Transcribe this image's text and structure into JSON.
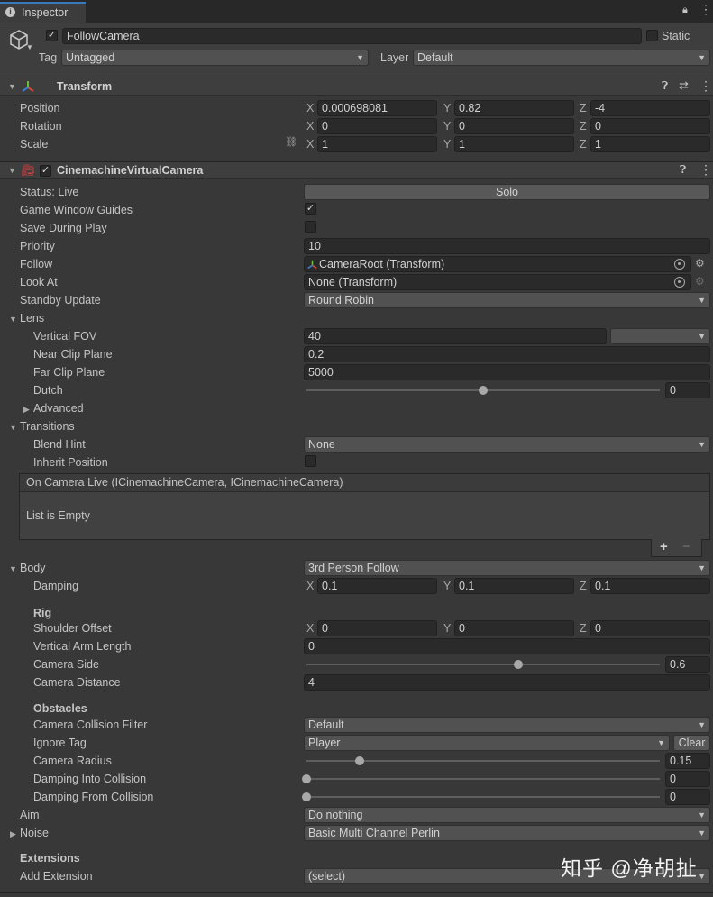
{
  "tab": {
    "title": "Inspector"
  },
  "gameobject": {
    "name": "FollowCamera",
    "static_label": "Static",
    "tag_label": "Tag",
    "tag_value": "Untagged",
    "layer_label": "Layer",
    "layer_value": "Default"
  },
  "transform": {
    "title": "Transform",
    "position_label": "Position",
    "rotation_label": "Rotation",
    "scale_label": "Scale",
    "axes": [
      "X",
      "Y",
      "Z"
    ],
    "position": [
      "0.000698081",
      "0.82",
      "-4"
    ],
    "rotation": [
      "0",
      "0",
      "0"
    ],
    "scale": [
      "1",
      "1",
      "1"
    ]
  },
  "vcam": {
    "title": "CinemachineVirtualCamera",
    "status_label": "Status: Live",
    "solo_label": "Solo",
    "game_window_guides_label": "Game Window Guides",
    "save_during_play_label": "Save During Play",
    "priority_label": "Priority",
    "priority_value": "10",
    "follow_label": "Follow",
    "follow_value": "CameraRoot (Transform)",
    "look_at_label": "Look At",
    "look_at_value": "None (Transform)",
    "standby_label": "Standby Update",
    "standby_value": "Round Robin",
    "lens": {
      "label": "Lens",
      "fov_label": "Vertical FOV",
      "fov_value": "40",
      "near_label": "Near Clip Plane",
      "near_value": "0.2",
      "far_label": "Far Clip Plane",
      "far_value": "5000",
      "dutch_label": "Dutch",
      "dutch_value": "0",
      "dutch_fraction": 0.5,
      "advanced_label": "Advanced"
    },
    "transitions": {
      "label": "Transitions",
      "blend_hint_label": "Blend Hint",
      "blend_hint_value": "None",
      "inherit_label": "Inherit Position",
      "event_title": "On Camera Live (ICinemachineCamera, ICinemachineCamera)",
      "event_empty": "List is Empty"
    },
    "body": {
      "label": "Body",
      "value": "3rd Person Follow",
      "damping_label": "Damping",
      "damping": [
        "0.1",
        "0.1",
        "0.1"
      ],
      "rig_label": "Rig",
      "shoulder_label": "Shoulder Offset",
      "shoulder": [
        "0",
        "0",
        "0"
      ],
      "arm_label": "Vertical Arm Length",
      "arm_value": "0",
      "side_label": "Camera Side",
      "side_value": "0.6",
      "side_fraction": 0.6,
      "distance_label": "Camera Distance",
      "distance_value": "4",
      "obstacles_label": "Obstacles",
      "filter_label": "Camera Collision Filter",
      "filter_value": "Default",
      "ignore_tag_label": "Ignore Tag",
      "ignore_tag_value": "Player",
      "clear_label": "Clear",
      "radius_label": "Camera Radius",
      "radius_value": "0.15",
      "radius_fraction": 0.15,
      "damp_into_label": "Damping Into Collision",
      "damp_into_value": "0",
      "damp_into_fraction": 0,
      "damp_from_label": "Damping From Collision",
      "damp_from_value": "0",
      "damp_from_fraction": 0
    },
    "aim_label": "Aim",
    "aim_value": "Do nothing",
    "noise_label": "Noise",
    "noise_value": "Basic Multi Channel Perlin",
    "extensions_label": "Extensions",
    "add_extension_label": "Add Extension",
    "add_extension_value": "(select)"
  },
  "watermark": "知乎 @净胡扯",
  "colors": {
    "tab_accent": "#3a79bb",
    "panel_bg": "#383838",
    "field_bg": "#2a2a2a"
  }
}
